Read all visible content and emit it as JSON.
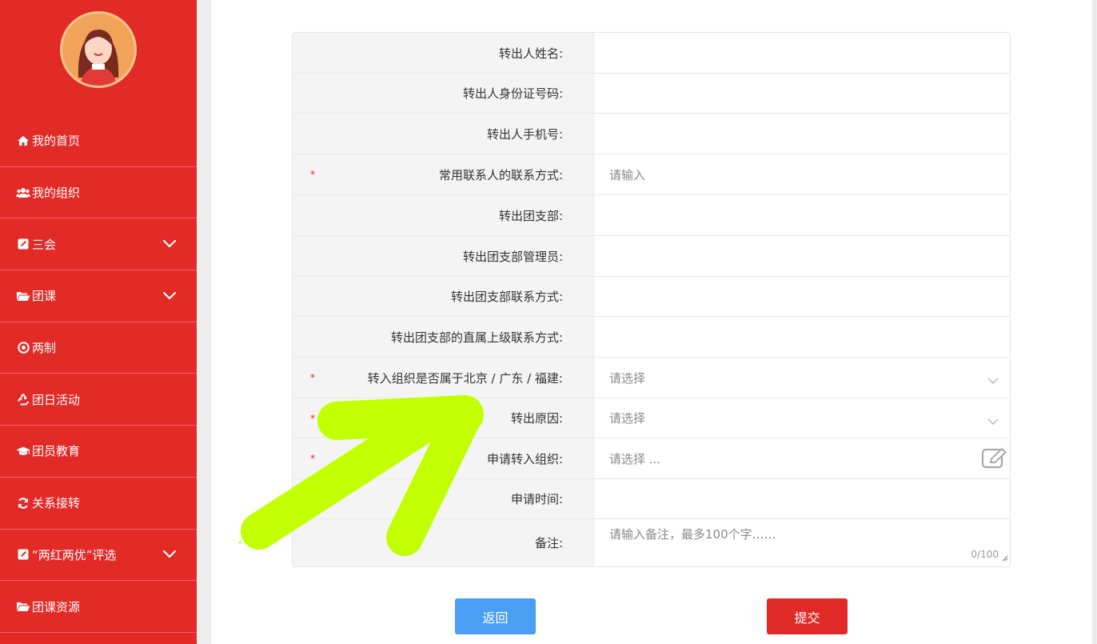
{
  "sidebar": {
    "items": [
      {
        "label": "我的首页",
        "icon": "home-icon",
        "expandable": false
      },
      {
        "label": "我的组织",
        "icon": "users-icon",
        "expandable": false
      },
      {
        "label": "三会",
        "icon": "edit-icon",
        "expandable": true
      },
      {
        "label": "团课",
        "icon": "folder-open-icon",
        "expandable": true
      },
      {
        "label": "两制",
        "icon": "target-icon",
        "expandable": false
      },
      {
        "label": "团日活动",
        "icon": "recycle-icon",
        "expandable": false
      },
      {
        "label": "团员教育",
        "icon": "graduation-cap-icon",
        "expandable": false
      },
      {
        "label": "关系接转",
        "icon": "refresh-icon",
        "expandable": false
      },
      {
        "label": "“两红两优”评选",
        "icon": "edit-icon",
        "expandable": true
      },
      {
        "label": "团课资源",
        "icon": "folder-open-icon",
        "expandable": false
      }
    ]
  },
  "form": {
    "rows": [
      {
        "label": "转出人姓名:",
        "required": false,
        "value": ""
      },
      {
        "label": "转出人身份证号码:",
        "required": false,
        "value": ""
      },
      {
        "label": "转出人手机号:",
        "required": false,
        "value": ""
      },
      {
        "label": "常用联系人的联系方式:",
        "required": true,
        "placeholder": "请输入"
      },
      {
        "label": "转出团支部:",
        "required": false,
        "value": ""
      },
      {
        "label": "转出团支部管理员:",
        "required": false,
        "value": ""
      },
      {
        "label": "转出团支部联系方式:",
        "required": false,
        "value": ""
      },
      {
        "label": "转出团支部的直属上级联系方式:",
        "required": false,
        "value": ""
      },
      {
        "label": "转入组织是否属于北京 / 广东 / 福建:",
        "required": true,
        "placeholder": "请选择"
      },
      {
        "label": "转出原因:",
        "required": true,
        "placeholder": "请选择"
      },
      {
        "label": "申请转入组织:",
        "required": true,
        "placeholder": "请选择 ..."
      },
      {
        "label": "申请时间:",
        "required": false,
        "value": ""
      },
      {
        "label": "备注:",
        "required": false,
        "placeholder": "请输入备注，最多100个字……",
        "counter": "0/100"
      }
    ],
    "required_mark": "*"
  },
  "buttons": {
    "back": "返回",
    "submit": "提交"
  },
  "colors": {
    "primary_red": "#e22a27",
    "back_blue": "#4a9ff5",
    "highlight_arrow": "#c2ff00"
  }
}
